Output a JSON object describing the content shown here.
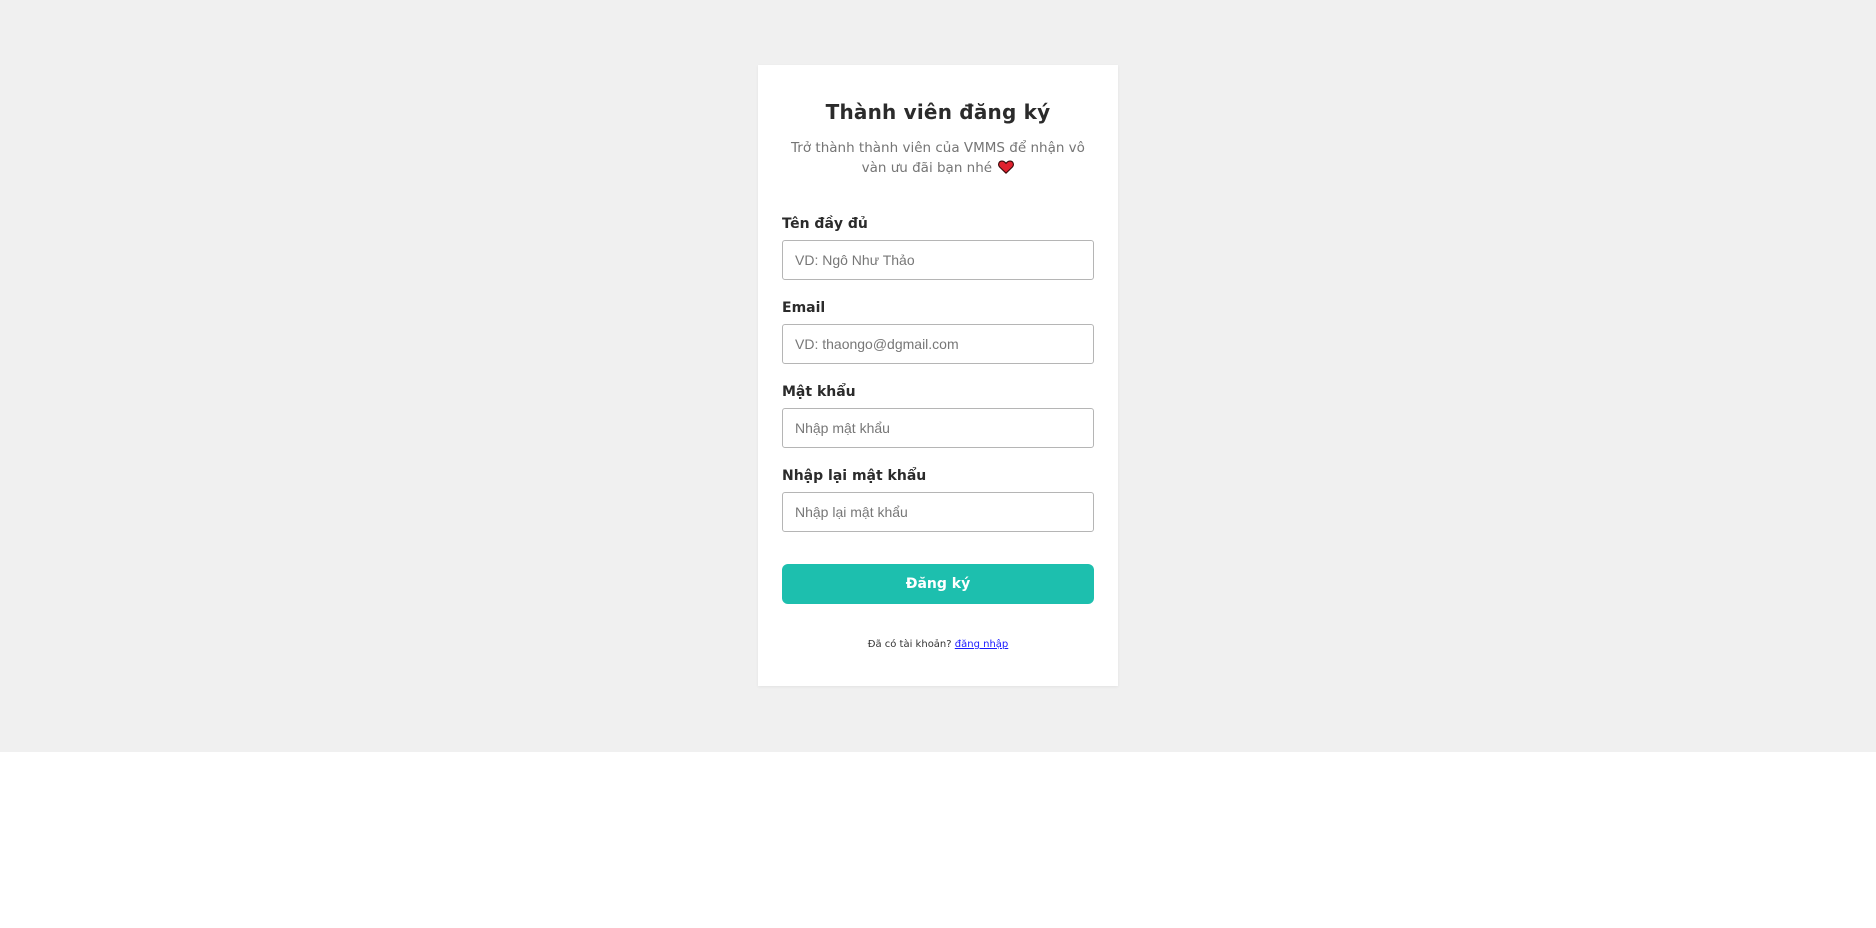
{
  "signup": {
    "title": "Thành viên đăng ký",
    "subtitle": "Trở thành thành viên của VMMS để nhận vô vàn ưu đãi bạn nhé",
    "subtitle_icon": "heart-icon",
    "fields": [
      {
        "label": "Tên đầy đủ",
        "placeholder": "VD: Ngô Như Thảo",
        "type": "text"
      },
      {
        "label": "Email",
        "placeholder": "VD: thaongo@dgmail.com",
        "type": "email"
      },
      {
        "label": "Mật khẩu",
        "placeholder": "Nhập mật khẩu",
        "type": "password"
      },
      {
        "label": "Nhập lại mật khẩu",
        "placeholder": "Nhập lại mật khẩu",
        "type": "password"
      }
    ],
    "submit_label": "Đăng ký",
    "footer_text": "Đã có tài khoản?",
    "login_link_label": "đăng nhập"
  },
  "colors": {
    "page_background": "#f0f0f0",
    "card_background": "#ffffff",
    "accent": "#1dbfae",
    "heart": "#e0212e",
    "link": "#1a1aff"
  }
}
